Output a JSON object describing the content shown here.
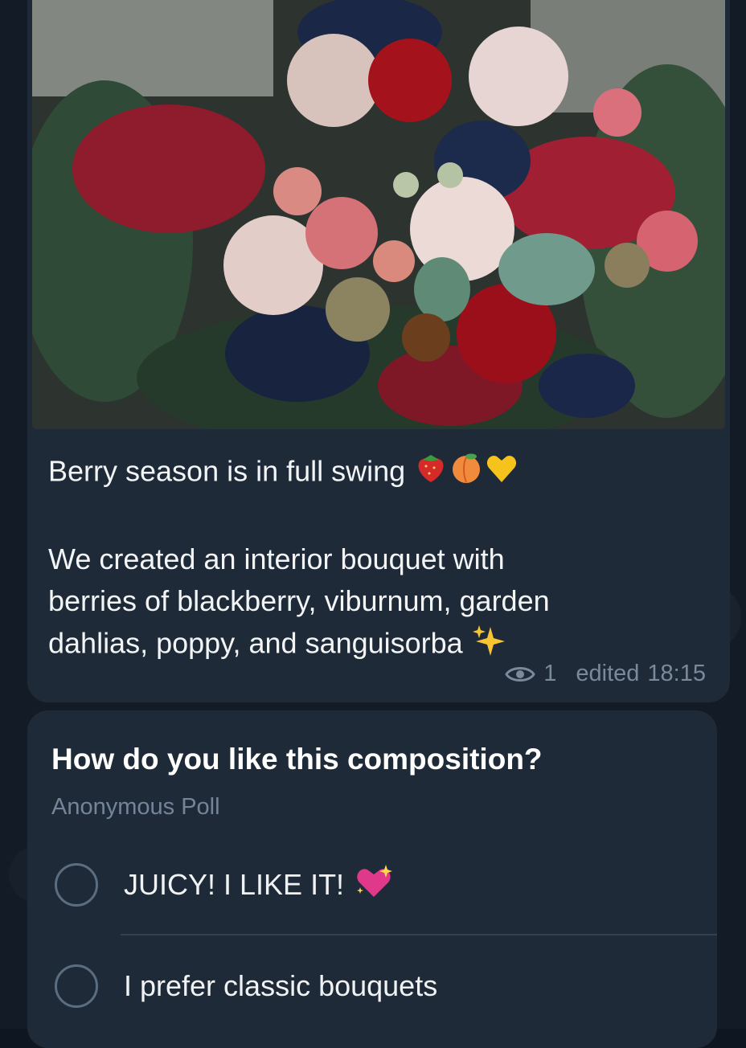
{
  "post": {
    "caption_line1": "Berry season is in full swing",
    "caption_line1_emojis": [
      "strawberry-emoji",
      "peach-emoji",
      "yellow-heart-emoji"
    ],
    "caption_para2_line1": "We created an interior bouquet with",
    "caption_para2_line2": "berries of blackberry, viburnum, garden",
    "caption_para2_line3": "dahlias, poppy, and sanguisorba",
    "caption_para2_emoji": "sparkles-emoji",
    "views": "1",
    "edited_label": "edited",
    "time": "18:15",
    "views_icon": "eye-icon"
  },
  "poll": {
    "question": "How do you like this composition?",
    "type": "Anonymous Poll",
    "options": [
      {
        "label": "JUICY! I LIKE IT!",
        "emoji": "sparkling-heart-emoji"
      },
      {
        "label": "I prefer classic bouquets"
      }
    ]
  },
  "colors": {
    "background": "#121b26",
    "bubble": "#1e2a37",
    "meta_text": "#7a8a9b",
    "radio_border": "#5b6d80"
  }
}
